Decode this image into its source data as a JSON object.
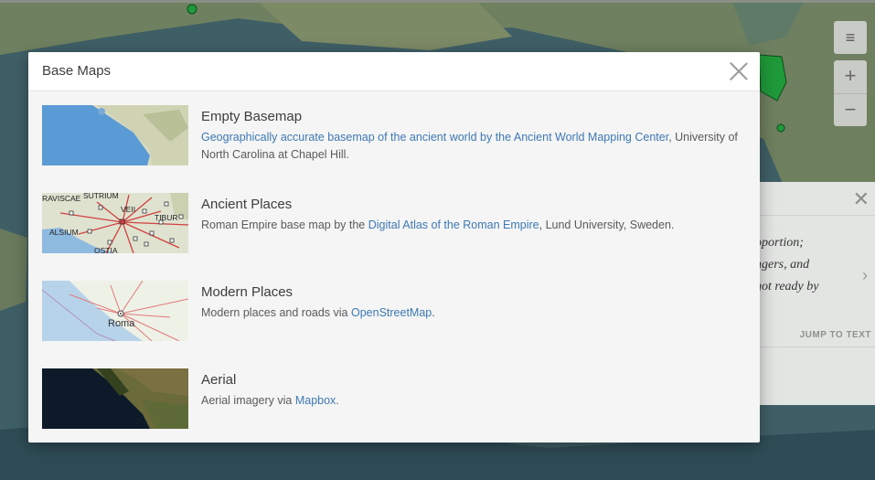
{
  "modal": {
    "title": "Base Maps",
    "items": [
      {
        "name": "Empty Basemap",
        "desc_pre": "",
        "link": "Geographically accurate basemap of the ancient world by the Ancient World Mapping Center",
        "desc_post": ", University of North Carolina at Chapel Hill.",
        "thumb_icon": "empty-basemap-thumbnail"
      },
      {
        "name": "Ancient Places",
        "desc_pre": "Roman Empire base map by the ",
        "link": "Digital Atlas of the Roman Empire",
        "desc_post": ", Lund University, Sweden.",
        "thumb_icon": "ancient-places-thumbnail",
        "thumb_labels": [
          "RAVISCAE",
          "SUTRIUM",
          "VEII",
          "TIBUR",
          "ALSIUM",
          "OSTIA"
        ]
      },
      {
        "name": "Modern Places",
        "desc_pre": "Modern places and roads via ",
        "link": "OpenStreetMap",
        "desc_post": ".",
        "thumb_icon": "modern-places-thumbnail",
        "thumb_labels": [
          "Roma"
        ]
      },
      {
        "name": "Aerial",
        "desc_pre": "Aerial imagery via ",
        "link": "Mapbox",
        "desc_post": ".",
        "thumb_icon": "aerial-thumbnail"
      }
    ]
  },
  "map_controls": {
    "layers_icon": "hamburger-menu-icon",
    "zoom_in": "+",
    "zoom_out": "−"
  },
  "side_panel": {
    "close": "✕",
    "quote": "oportion;\nngers, and\ngot ready by",
    "arrow": "›",
    "jump": "JUMP TO TEXT"
  },
  "colors": {
    "link": "#3f78b3",
    "overlay_map": "#4d6e5f",
    "place_marker": "#1f9a3a"
  }
}
